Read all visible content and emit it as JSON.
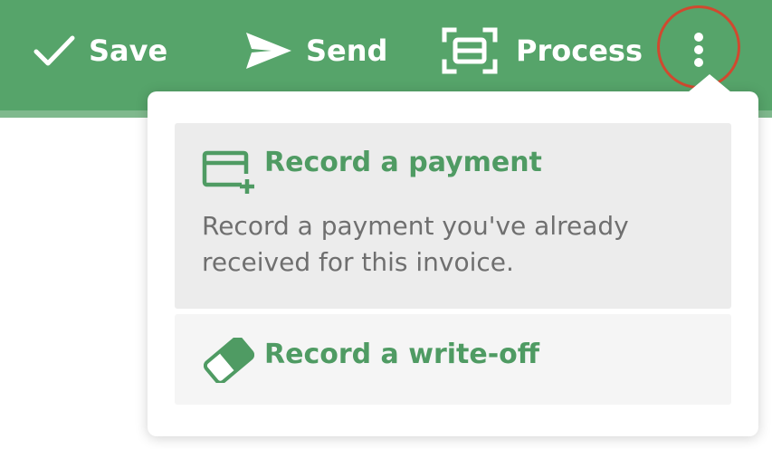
{
  "toolbar": {
    "save_label": "Save",
    "send_label": "Send",
    "process_label": "Process"
  },
  "menu": {
    "items": [
      {
        "title": "Record a payment",
        "description": "Record a payment you've already received for this invoice.",
        "icon": "card-plus-icon"
      },
      {
        "title": "Record a write-off",
        "icon": "eraser-icon"
      }
    ]
  },
  "colors": {
    "toolbar_bg": "#56a46a",
    "accent_green": "#4f9b63",
    "highlight_ring": "#d0492f",
    "item_bg_active": "#ececec",
    "item_bg": "#f5f5f5",
    "description_text": "#6f6f6f"
  }
}
